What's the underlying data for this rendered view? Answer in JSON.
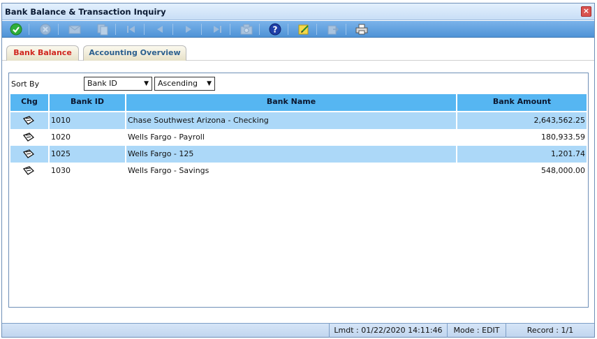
{
  "window": {
    "title": "Bank Balance & Transaction Inquiry"
  },
  "toolbar": {
    "buttons": [
      {
        "icon": "check-icon",
        "enabled": true
      },
      {
        "icon": "cancel-icon",
        "enabled": false
      },
      {
        "icon": "mail-icon",
        "enabled": false
      },
      {
        "icon": "copy-icon",
        "enabled": false
      },
      {
        "icon": "first-icon",
        "enabled": false
      },
      {
        "icon": "prev-icon",
        "enabled": false
      },
      {
        "icon": "next-icon",
        "enabled": false
      },
      {
        "icon": "last-icon",
        "enabled": false
      },
      {
        "icon": "camera-icon",
        "enabled": false
      },
      {
        "icon": "help-icon",
        "enabled": true
      },
      {
        "icon": "notes-icon",
        "enabled": true
      },
      {
        "icon": "export-icon",
        "enabled": false
      },
      {
        "icon": "print-icon",
        "enabled": true
      }
    ]
  },
  "tabs": [
    {
      "label": "Bank Balance",
      "active": true
    },
    {
      "label": "Accounting Overview",
      "active": false
    }
  ],
  "sort": {
    "label": "Sort By",
    "field": "Bank ID",
    "order": "Ascending"
  },
  "grid": {
    "headers": {
      "chg": "Chg",
      "bank_id": "Bank ID",
      "bank_name": "Bank Name",
      "bank_amount": "Bank Amount"
    },
    "rows": [
      {
        "bank_id": "1010",
        "bank_name": "Chase Southwest Arizona - Checking",
        "bank_amount": "2,643,562.25"
      },
      {
        "bank_id": "1020",
        "bank_name": "Wells Fargo - Payroll",
        "bank_amount": "180,933.59"
      },
      {
        "bank_id": "1025",
        "bank_name": "Wells Fargo - 125",
        "bank_amount": "1,201.74"
      },
      {
        "bank_id": "1030",
        "bank_name": "Wells Fargo - Savings",
        "bank_amount": "548,000.00"
      }
    ]
  },
  "status": {
    "lmdt": "Lmdt : 01/22/2020 14:11:46",
    "mode": "Mode : EDIT",
    "record": "Record : 1/1"
  },
  "colors": {
    "header_blue": "#56b6f2",
    "row_alt": "#acd8f8",
    "active_tab_text": "#d0261f",
    "inactive_tab_text": "#2b5f8e"
  }
}
